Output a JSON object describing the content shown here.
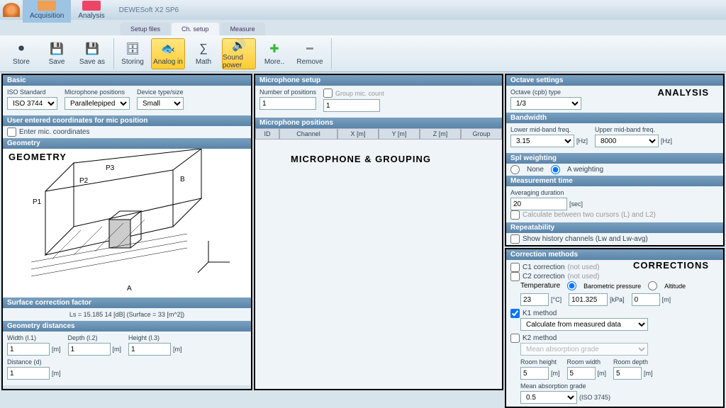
{
  "app": {
    "title": "DEWESoft X2 SP6"
  },
  "topnav": {
    "acquisition": "Acquisition",
    "analysis": "Analysis"
  },
  "tabs": {
    "setup_files": "Setup files",
    "ch_setup": "Ch. setup",
    "measure": "Measure"
  },
  "toolbar": {
    "store": "Store",
    "save": "Save",
    "saveas": "Save as",
    "storing": "Storing",
    "analogin": "Analog in",
    "math": "Math",
    "soundpower": "Sound power",
    "more": "More..",
    "remove": "Remove"
  },
  "basic": {
    "hdr": "Basic",
    "iso_label": "ISO Standard",
    "iso_value": "ISO 3744",
    "mic_pos_label": "Microphone positions",
    "mic_pos_value": "Parallelepiped",
    "device_label": "Device type/size",
    "device_value": "Small"
  },
  "user_coords": {
    "hdr": "User entered coordinates for mic position",
    "checkbox": "Enter mic. coordinates"
  },
  "geometry": {
    "hdr": "Geometry",
    "overlay": "GEOMETRY"
  },
  "surface": {
    "hdr": "Surface correction factor",
    "text": "Ls = 15.185 14 [dB] (Surface = 33 [m^2])"
  },
  "geom_dist": {
    "hdr": "Geometry distances",
    "width_label": "Width (l.1)",
    "width_value": "1",
    "depth_label": "Depth (l.2)",
    "depth_value": "1",
    "height_label": "Height (l.3)",
    "height_value": "1",
    "distance_label": "Distance (d)",
    "distance_value": "1",
    "unit": "[m]"
  },
  "mic_setup": {
    "hdr": "Microphone setup",
    "num_pos_label": "Number of positions",
    "num_pos_value": "1",
    "group_label": "Group mic. count",
    "group_value": "1",
    "overlay": "MICROPHONE & GROUPING"
  },
  "mic_positions": {
    "hdr": "Microphone positions",
    "cols": {
      "id": "ID",
      "channel": "Channel",
      "x": "X [m]",
      "y": "Y [m]",
      "z": "Z [m]",
      "group": "Group"
    }
  },
  "octave": {
    "hdr": "Octave settings",
    "overlay": "ANALYSIS",
    "type_label": "Octave (cpb) type",
    "type_value": "1/3"
  },
  "bandwidth": {
    "hdr": "Bandwidth",
    "lower_label": "Lower mid-band freq.",
    "lower_value": "3.15",
    "lower_unit": "[Hz]",
    "upper_label": "Upper mid-band freq.",
    "upper_value": "8000",
    "upper_unit": "[Hz]"
  },
  "spl": {
    "hdr": "Spl weighting",
    "none": "None",
    "a": "A weighting"
  },
  "meas_time": {
    "hdr": "Measurement time",
    "avg_label": "Averaging duration",
    "avg_value": "20",
    "avg_unit": "[sec]",
    "calc": "Calculate between two cursors (L) and L2)"
  },
  "repeat": {
    "hdr": "Repeatability",
    "show": "Show history channels (Lw and Lw-avg)"
  },
  "corrections": {
    "hdr": "Correction methods",
    "overlay": "CORRECTIONS",
    "c1": "C1 correction",
    "c2": "C2 correction",
    "not_used": "(not used)",
    "temp_label": "Temperature",
    "temp_value": "23",
    "temp_unit": "[°C]",
    "baro_label": "Barometric pressure",
    "baro_value": "101.325",
    "baro_unit": "[kPa]",
    "alt_label": "Altitude",
    "alt_value": "0",
    "alt_unit": "[m]",
    "k1": "K1 method",
    "k1_select": "Calculate from measured data",
    "k2": "K2 method",
    "k2_select": "Mean absorption grade",
    "rh_label": "Room height",
    "rh_value": "5",
    "rw_label": "Room width",
    "rw_value": "5",
    "rd_label": "Room depth",
    "rd_value": "5",
    "room_unit": "[m]",
    "mag_label": "Mean absorption grade",
    "mag_value": "0.5",
    "mag_iso": "(ISO 3745)"
  }
}
